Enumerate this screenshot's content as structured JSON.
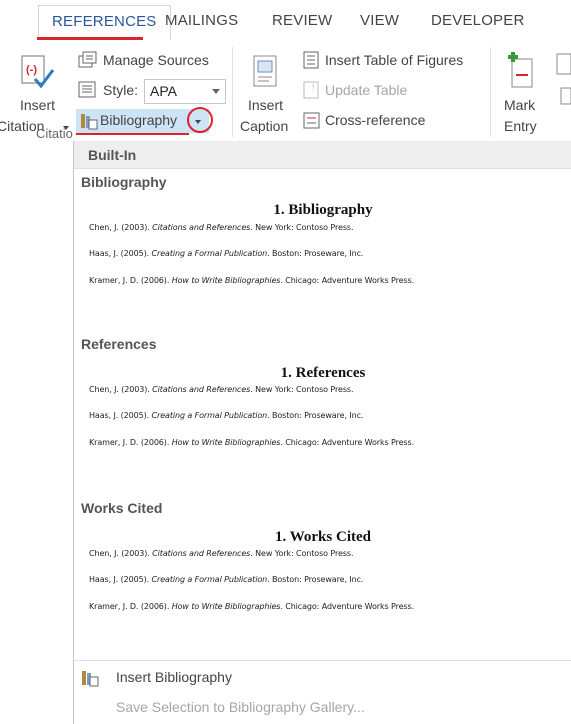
{
  "tabs": [
    {
      "label": "REFERENCES",
      "active": true
    },
    {
      "label": "MAILINGS"
    },
    {
      "label": "REVIEW"
    },
    {
      "label": "VIEW"
    },
    {
      "label": "DEVELOPER"
    }
  ],
  "ribbon": {
    "insert_citation": {
      "line1": "Insert",
      "line2": "Citation"
    },
    "manage_sources": "Manage Sources",
    "style_label": "Style:",
    "style_value": "APA",
    "bibliography": "Bibliography",
    "insert_caption": {
      "line1": "Insert",
      "line2": "Caption"
    },
    "insert_table_of_figures": "Insert Table of Figures",
    "update_table": "Update Table",
    "cross_reference": "Cross-reference",
    "mark_entry": {
      "line1": "Mark",
      "line2": "Entry"
    },
    "group_caption": "Citatio"
  },
  "gallery": {
    "header": "Built-In",
    "sections": [
      {
        "title": "Bibliography",
        "heading": "1. Bibliography",
        "entries": [
          {
            "pre": "Chen, J. (2003). ",
            "italic": "Citations and References",
            "post": ". New York: Contoso Press."
          },
          {
            "pre": "Haas, J. (2005). ",
            "italic": "Creating a Formal Publication",
            "post": ". Boston: Proseware, Inc."
          },
          {
            "pre": "Kramer, J. D. (2006). ",
            "italic": "How to Write Bibliographies",
            "post": ". Chicago: Adventure Works Press."
          }
        ]
      },
      {
        "title": "References",
        "heading": "1. References",
        "entries": [
          {
            "pre": "Chen, J. (2003). ",
            "italic": "Citations and References",
            "post": ". New York: Contoso Press."
          },
          {
            "pre": "Haas, J. (2005). ",
            "italic": "Creating a Formal Publication",
            "post": ". Boston: Proseware, Inc."
          },
          {
            "pre": "Kramer, J. D. (2006). ",
            "italic": "How to Write Bibliographies",
            "post": ". Chicago: Adventure Works Press."
          }
        ]
      },
      {
        "title": "Works Cited",
        "heading": "1. Works Cited",
        "entries": [
          {
            "pre": "Chen, J. (2003). ",
            "italic": "Citations and References",
            "post": ". New York: Contoso Press."
          },
          {
            "pre": "Haas, J. (2005). ",
            "italic": "Creating a Formal Publication",
            "post": ". Boston: Proseware, Inc."
          },
          {
            "pre": "Kramer, J. D. (2006). ",
            "italic": "How to Write Bibliographies",
            "post": ". Chicago: Adventure Works Press."
          }
        ]
      }
    ],
    "menu": {
      "insert_bibliography": "Insert Bibliography",
      "save_selection": "Save Selection to Bibliography Gallery..."
    }
  },
  "colors": {
    "accent_blue": "#2b579a",
    "highlight_blue": "#cde4f7",
    "annotation_red": "#d9262c",
    "green_plus": "#3a9a3a"
  }
}
